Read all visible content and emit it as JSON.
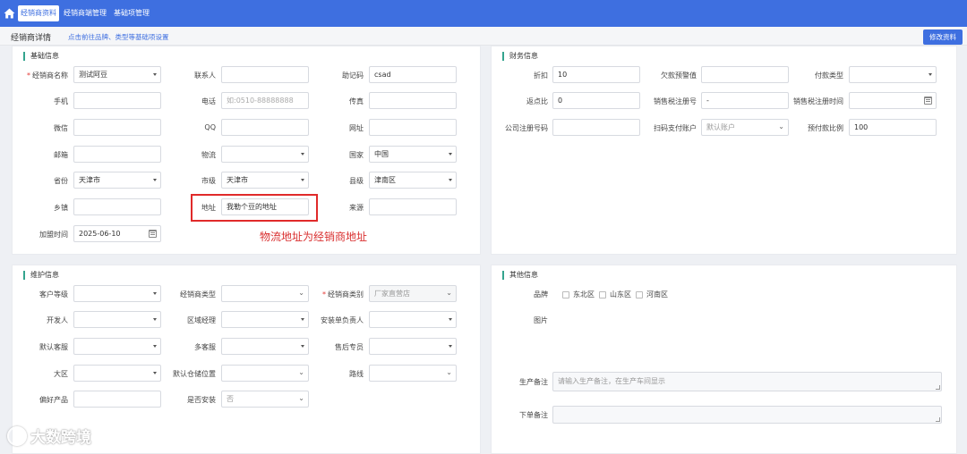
{
  "nav": {
    "tabs": [
      "经销商资料",
      "经销商端管理",
      "基础项管理"
    ]
  },
  "subheader": {
    "title": "经销商详情",
    "hint": "点击前往品牌、类型等基础项设置",
    "edit_label": "修改资料"
  },
  "basic": {
    "title": "基础信息",
    "fields": {
      "dealer_name": {
        "label": "经销商名称",
        "value": "测试阿豆"
      },
      "contact": {
        "label": "联系人",
        "value": ""
      },
      "mnemonic": {
        "label": "助记码",
        "value": "csad"
      },
      "mobile": {
        "label": "手机",
        "value": ""
      },
      "phone": {
        "label": "电话",
        "placeholder": "如:0510-88888888"
      },
      "fax": {
        "label": "传真",
        "value": ""
      },
      "wechat": {
        "label": "微信",
        "value": ""
      },
      "qq": {
        "label": "QQ",
        "value": ""
      },
      "website": {
        "label": "网址",
        "value": ""
      },
      "email": {
        "label": "邮箱",
        "value": ""
      },
      "logistics": {
        "label": "物流",
        "value": ""
      },
      "country": {
        "label": "国家",
        "value": "中国"
      },
      "province": {
        "label": "省份",
        "value": "天津市"
      },
      "city": {
        "label": "市级",
        "value": "天津市"
      },
      "county": {
        "label": "县级",
        "value": "津南区"
      },
      "town": {
        "label": "乡镇",
        "value": ""
      },
      "address": {
        "label": "地址",
        "value": "我勒个豆的地址"
      },
      "source": {
        "label": "来源",
        "value": ""
      },
      "join_time": {
        "label": "加盟时间",
        "value": "2025-06-10"
      }
    },
    "annotation": "物流地址为经销商地址"
  },
  "finance": {
    "title": "财务信息",
    "fields": {
      "discount": {
        "label": "折扣",
        "value": "10"
      },
      "arrears_warning": {
        "label": "欠款预警值",
        "value": ""
      },
      "payment_type": {
        "label": "付款类型",
        "value": ""
      },
      "rebate_ratio": {
        "label": "返点比",
        "value": "0"
      },
      "tax_no": {
        "label": "销售税注册号",
        "value": "-"
      },
      "tax_time": {
        "label": "销售税注册时间",
        "value": ""
      },
      "company_reg_no": {
        "label": "公司注册号码",
        "value": ""
      },
      "scan_account": {
        "label": "扫码支付账户",
        "value": "默认账户"
      },
      "prepay_ratio": {
        "label": "预付款比例",
        "value": "100"
      }
    }
  },
  "maintenance": {
    "title": "维护信息",
    "fields": {
      "customer_level": {
        "label": "客户等级",
        "value": ""
      },
      "dealer_type": {
        "label": "经销商类型",
        "value": ""
      },
      "dealer_category": {
        "label": "经销商类别",
        "value": "厂家直营店"
      },
      "developer": {
        "label": "开发人",
        "value": ""
      },
      "regional_manager": {
        "label": "区域经理",
        "value": ""
      },
      "installer": {
        "label": "安装单负责人",
        "value": ""
      },
      "default_service": {
        "label": "默认客服",
        "value": ""
      },
      "multi_service": {
        "label": "多客服",
        "value": ""
      },
      "after_sales": {
        "label": "售后专员",
        "value": ""
      },
      "region": {
        "label": "大区",
        "value": ""
      },
      "warehouse": {
        "label": "默认仓储位置",
        "value": ""
      },
      "route": {
        "label": "路线",
        "value": ""
      },
      "preferred": {
        "label": "偏好产品",
        "value": ""
      },
      "install": {
        "label": "是否安装",
        "value": "否"
      }
    }
  },
  "other": {
    "title": "其他信息",
    "brand_label": "品牌",
    "brands": [
      "东北区",
      "山东区",
      "河南区"
    ],
    "image_label": "图片",
    "production_note": {
      "label": "生产备注",
      "placeholder": "请输入生产备注，在生产车间显示"
    },
    "order_note": {
      "label": "下单备注",
      "value": ""
    }
  },
  "watermark": {
    "text": "大数跨境"
  },
  "colors": {
    "primary": "#3e6fe0",
    "accent": "#34a48e",
    "annotation": "#d93030"
  }
}
